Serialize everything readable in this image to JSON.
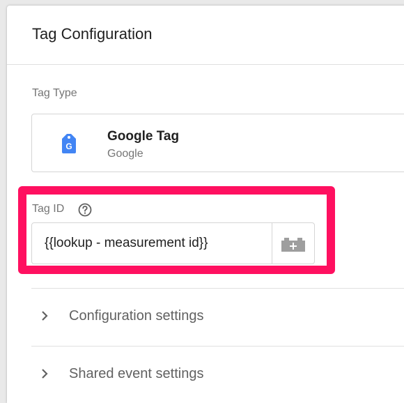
{
  "header": {
    "title": "Tag Configuration"
  },
  "tag_type": {
    "section_label": "Tag Type",
    "name": "Google Tag",
    "vendor": "Google",
    "icon": "google-tag-icon",
    "icon_letter": "G",
    "icon_color": "#4285f4"
  },
  "tag_id": {
    "label": "Tag ID",
    "help_icon": "help-circle-icon",
    "value": "{{lookup - measurement id}}",
    "variable_icon": "variable-block-icon",
    "highlight_color": "#ff1060"
  },
  "sections": [
    {
      "label": "Configuration settings",
      "icon": "chevron-right-icon"
    },
    {
      "label": "Shared event settings",
      "icon": "chevron-right-icon"
    }
  ]
}
